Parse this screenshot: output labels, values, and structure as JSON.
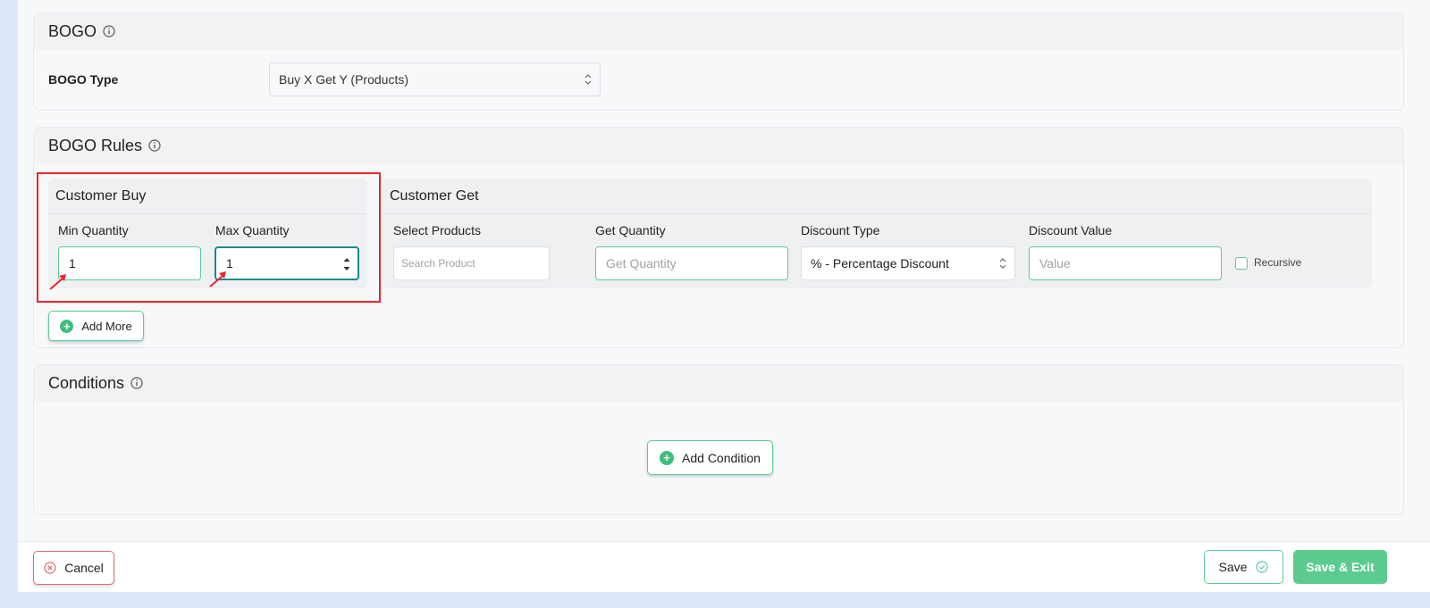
{
  "bogo": {
    "title": "BOGO",
    "type_label": "BOGO Type",
    "type_value": "Buy X Get Y (Products)"
  },
  "rules": {
    "title": "BOGO Rules",
    "customer_buy": {
      "title": "Customer Buy",
      "min_label": "Min Quantity",
      "min_value": "1",
      "max_label": "Max Quantity",
      "max_value": "1"
    },
    "customer_get": {
      "title": "Customer Get",
      "products_label": "Select Products",
      "products_placeholder": "Search Product",
      "quantity_label": "Get Quantity",
      "quantity_placeholder": "Get Quantity",
      "discount_type_label": "Discount Type",
      "discount_type_value": "% - Percentage Discount",
      "discount_value_label": "Discount Value",
      "discount_value_placeholder": "Value",
      "recursive_label": "Recursive"
    },
    "add_more_label": "Add More"
  },
  "conditions": {
    "title": "Conditions",
    "add_condition_label": "Add Condition"
  },
  "footer": {
    "cancel_label": "Cancel",
    "save_label": "Save",
    "save_exit_label": "Save & Exit"
  },
  "colors": {
    "accent_green": "#5dcb95",
    "highlight_red": "#e8262b",
    "focus_teal": "#1f8a8a"
  }
}
